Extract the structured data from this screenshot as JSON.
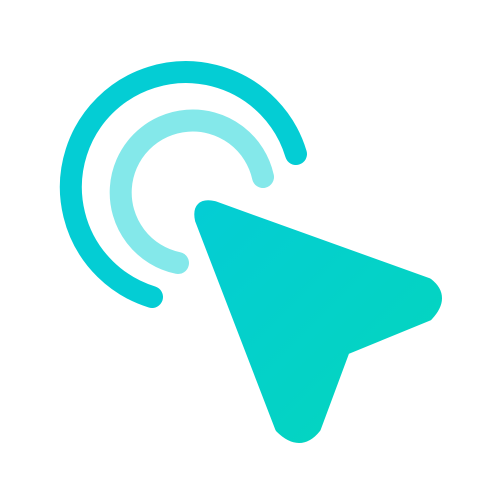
{
  "icon": {
    "name": "click-cursor-icon",
    "background_color": "#ffffff",
    "outer_ring_color": "#04cdd4",
    "inner_ring_color": "#84e8ea",
    "cursor_color": "#04d3c2"
  }
}
